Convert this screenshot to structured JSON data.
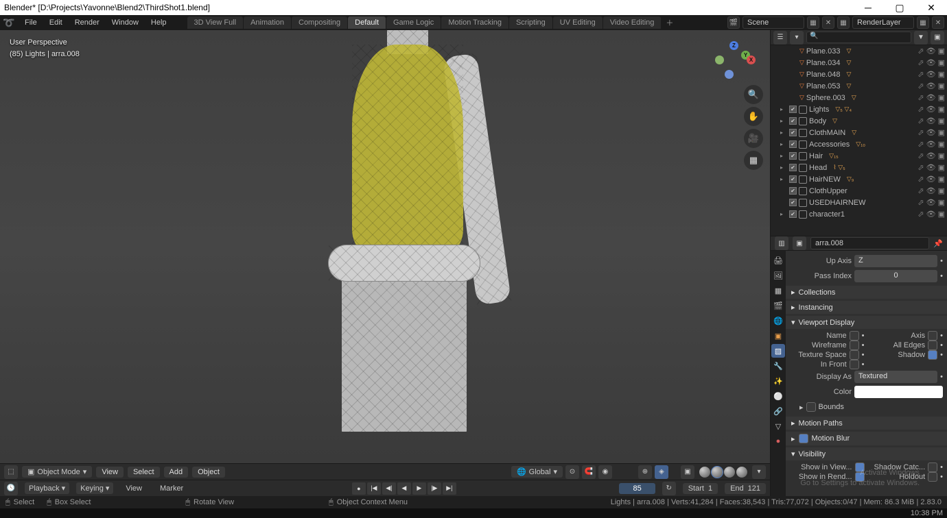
{
  "title": "Blender* [D:\\Projects\\Yavonne\\Blend2\\ThirdShot1.blend]",
  "menu": [
    "File",
    "Edit",
    "Render",
    "Window",
    "Help"
  ],
  "workspaces": [
    "3D View Full",
    "Animation",
    "Compositing",
    "Default",
    "Game Logic",
    "Motion Tracking",
    "Scripting",
    "UV Editing",
    "Video Editing"
  ],
  "active_workspace": "Default",
  "scene": {
    "label": "Scene",
    "render_layer": "RenderLayer"
  },
  "viewport": {
    "label_line1": "User Perspective",
    "label_line2": "(85) Lights | arra.008",
    "mode": "Object Mode",
    "mode_menu": [
      "View",
      "Select",
      "Add",
      "Object"
    ],
    "orientation": "Global"
  },
  "outliner": {
    "meshes": [
      "Plane.033",
      "Plane.034",
      "Plane.048",
      "Plane.053",
      "Sphere.003"
    ],
    "collections": [
      {
        "name": "Lights",
        "badge": "▽₅ ▽₄"
      },
      {
        "name": "Body",
        "badge": "▽"
      },
      {
        "name": "ClothMAIN",
        "badge": "▽"
      },
      {
        "name": "Accessories",
        "badge": "▽₁₀"
      },
      {
        "name": "Hair",
        "badge": "▽₁₅"
      },
      {
        "name": "Head",
        "badge": "⌇ ▽₅"
      },
      {
        "name": "HairNEW",
        "badge": "▽₉"
      },
      {
        "name": "ClothUpper",
        "badge": ""
      },
      {
        "name": "USEDHAIRNEW",
        "badge": ""
      },
      {
        "name": "character1",
        "badge": ""
      }
    ]
  },
  "properties": {
    "object": "arra.008",
    "up_axis_label": "Up Axis",
    "up_axis": "Z",
    "pass_index_label": "Pass Index",
    "pass_index": "0",
    "panels": {
      "collections": "Collections",
      "instancing": "Instancing",
      "viewport_display": "Viewport Display",
      "motion_paths": "Motion Paths",
      "motion_blur": "Motion Blur",
      "visibility": "Visibility"
    },
    "vp": {
      "name": "Name",
      "axis": "Axis",
      "wireframe": "Wireframe",
      "all_edges": "All Edges",
      "texture_space": "Texture Space",
      "shadow": "Shadow",
      "in_front": "In Front",
      "display_as_label": "Display As",
      "display_as": "Textured",
      "color": "Color",
      "bounds": "Bounds"
    },
    "visibility": {
      "show_in_view": "Show in View...",
      "shadow_catcher": "Shadow Catc...",
      "show_in_rend": "Show in Rend...",
      "holdout": "Holdout"
    }
  },
  "timeline": {
    "playback": "Playback",
    "keying": "Keying",
    "view": "View",
    "marker": "Marker",
    "current": "85",
    "start_l": "Start",
    "start": "1",
    "end_l": "End",
    "end": "121"
  },
  "status": {
    "select": "Select",
    "box_select": "Box Select",
    "rotate": "Rotate View",
    "ctx_menu": "Object Context Menu",
    "stats": "Lights | arra.008 | Verts:41,284 | Faces:38,543 | Tris:77,072 | Objects:0/47 | Mem: 86.3 MiB | 2.83.0"
  },
  "activate": {
    "title": "Activate Windows",
    "sub": "Go to Settings to activate Windows."
  },
  "clock": "10:38 PM"
}
